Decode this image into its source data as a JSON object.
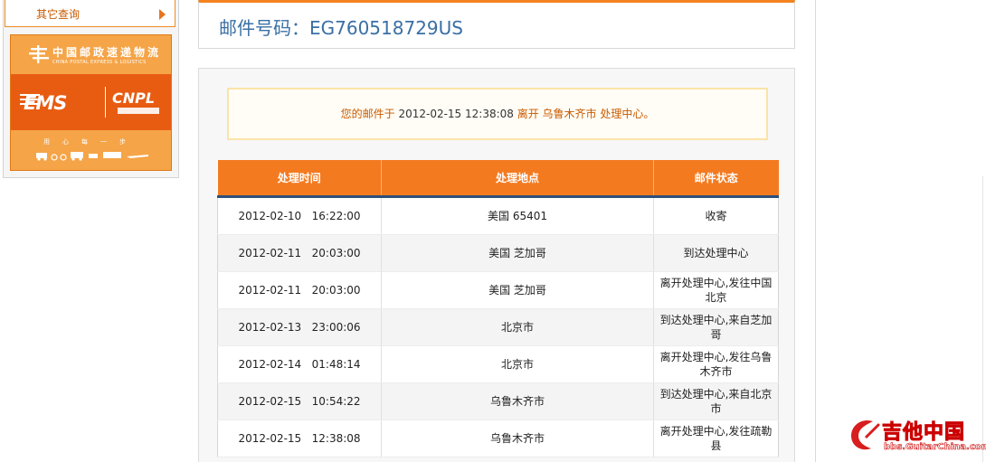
{
  "sidebar": {
    "query_label": "其它查询",
    "banner": {
      "cn_name": "中国邮政速递物流",
      "en_name": "CHINA POSTAL EXPRESS & LOGISTICS",
      "ems": "EMS",
      "cnpl": "CNPL",
      "slogan": "用心每一步"
    }
  },
  "header": {
    "label": "邮件号码：",
    "tracking_number": "EG760518729US"
  },
  "status": {
    "prefix": "您的邮件于",
    "time": "2012-02-15 12:38:08",
    "suffix": "离开 乌鲁木齐市 处理中心。"
  },
  "table": {
    "columns": [
      "处理时间",
      "处理地点",
      "邮件状态"
    ],
    "rows": [
      {
        "time": "2012-02-10   16:22:00",
        "location": "美国 65401",
        "state": "收寄"
      },
      {
        "time": "2012-02-11   20:03:00",
        "location": "美国 芝加哥",
        "state": "到达处理中心"
      },
      {
        "time": "2012-02-11   20:03:00",
        "location": "美国 芝加哥",
        "state": "离开处理中心,发往中国北京"
      },
      {
        "time": "2012-02-13   23:00:06",
        "location": "北京市",
        "state": "到达处理中心,来自芝加哥"
      },
      {
        "time": "2012-02-14   01:48:14",
        "location": "北京市",
        "state": "离开处理中心,发往乌鲁木齐市"
      },
      {
        "time": "2012-02-15   10:54:22",
        "location": "乌鲁木齐市",
        "state": "到达处理中心,来自北京市"
      },
      {
        "time": "2012-02-15   12:38:08",
        "location": "乌鲁木齐市",
        "state": "离开处理中心,发往疏勒县"
      }
    ]
  },
  "watermark": {
    "text": "吉他中国",
    "url": "bbs.GuitarChina.com"
  },
  "colors": {
    "accent": "#f47a20",
    "header_underline": "#2c4f7a",
    "title_blue": "#3a6fa5",
    "message_orange": "#c95a00"
  }
}
